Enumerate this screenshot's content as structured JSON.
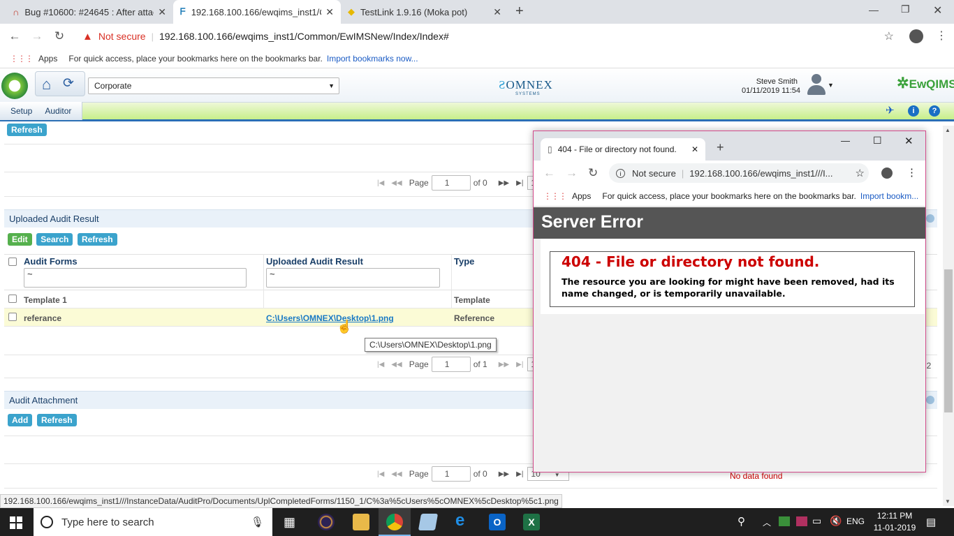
{
  "tabs": [
    {
      "title": "Bug #10600: #24645 : After attac"
    },
    {
      "title": "192.168.100.166/ewqims_inst1/C"
    },
    {
      "title": "TestLink 1.9.16 (Moka pot)"
    }
  ],
  "address": {
    "security": "Not secure",
    "url": "192.168.100.166/ewqims_inst1/Common/EwIMSNew/Index/Index#"
  },
  "bookmarks": {
    "apps": "Apps",
    "hint": "For quick access, place your bookmarks here on the bookmarks bar.",
    "import": "Import bookmarks now..."
  },
  "app": {
    "org": "Corporate",
    "logo": "OMNEX",
    "logo_sub": "SYSTEMS",
    "user": "Steve Smith",
    "datetime": "01/11/2019 11:54",
    "brand": "EwQIMS",
    "menu": [
      "Setup",
      "Auditor"
    ]
  },
  "top_section": {
    "refresh": "Refresh",
    "pager": {
      "page_label": "Page",
      "page": "1",
      "of": "of 0",
      "size": "10"
    }
  },
  "uploaded": {
    "title": "Uploaded Audit Result",
    "buttons": {
      "edit": "Edit",
      "search": "Search",
      "refresh": "Refresh"
    },
    "columns": [
      "Audit Forms",
      "Uploaded Audit Result",
      "Type"
    ],
    "filter": "~",
    "rows": [
      {
        "form": "Template 1",
        "result": "",
        "type": "Template"
      },
      {
        "form": "referance",
        "result": "C:\\Users\\OMNEX\\Desktop\\1.png",
        "type": "Reference"
      }
    ],
    "tooltip": "C:\\Users\\OMNEX\\Desktop\\1.png",
    "pager": {
      "page_label": "Page",
      "page": "1",
      "of": "of 1",
      "size": "10",
      "count": "f 2"
    }
  },
  "attachment": {
    "title": "Audit Attachment",
    "buttons": {
      "add": "Add",
      "refresh": "Refresh"
    },
    "pager": {
      "page_label": "Page",
      "page": "1",
      "of": "of 0",
      "size": "10"
    },
    "empty": "No data found"
  },
  "popup": {
    "tab_title": "404 - File or directory not found.",
    "security": "Not secure",
    "url": "192.168.100.166/ewqims_inst1///I...",
    "bookmarks_apps": "Apps",
    "bookmarks_hint": "For quick access, place your bookmarks here on the bookmarks bar.",
    "bookmarks_import": "Import bookm...",
    "banner": "Server Error",
    "error_title": "404 - File or directory not found.",
    "error_text": "The resource you are looking for might have been removed, had its name changed, or is temporarily unavailable."
  },
  "status_url": "192.168.100.166/ewqims_inst1///InstanceData/AuditPro/Documents/UplCompletedForms/1150_1/C%3a%5cUsers%5cOMNEX%5cDesktop%5c1.png",
  "taskbar": {
    "search": "Type here to search",
    "lang": "ENG",
    "time": "12:11 PM",
    "date": "11-01-2019"
  }
}
